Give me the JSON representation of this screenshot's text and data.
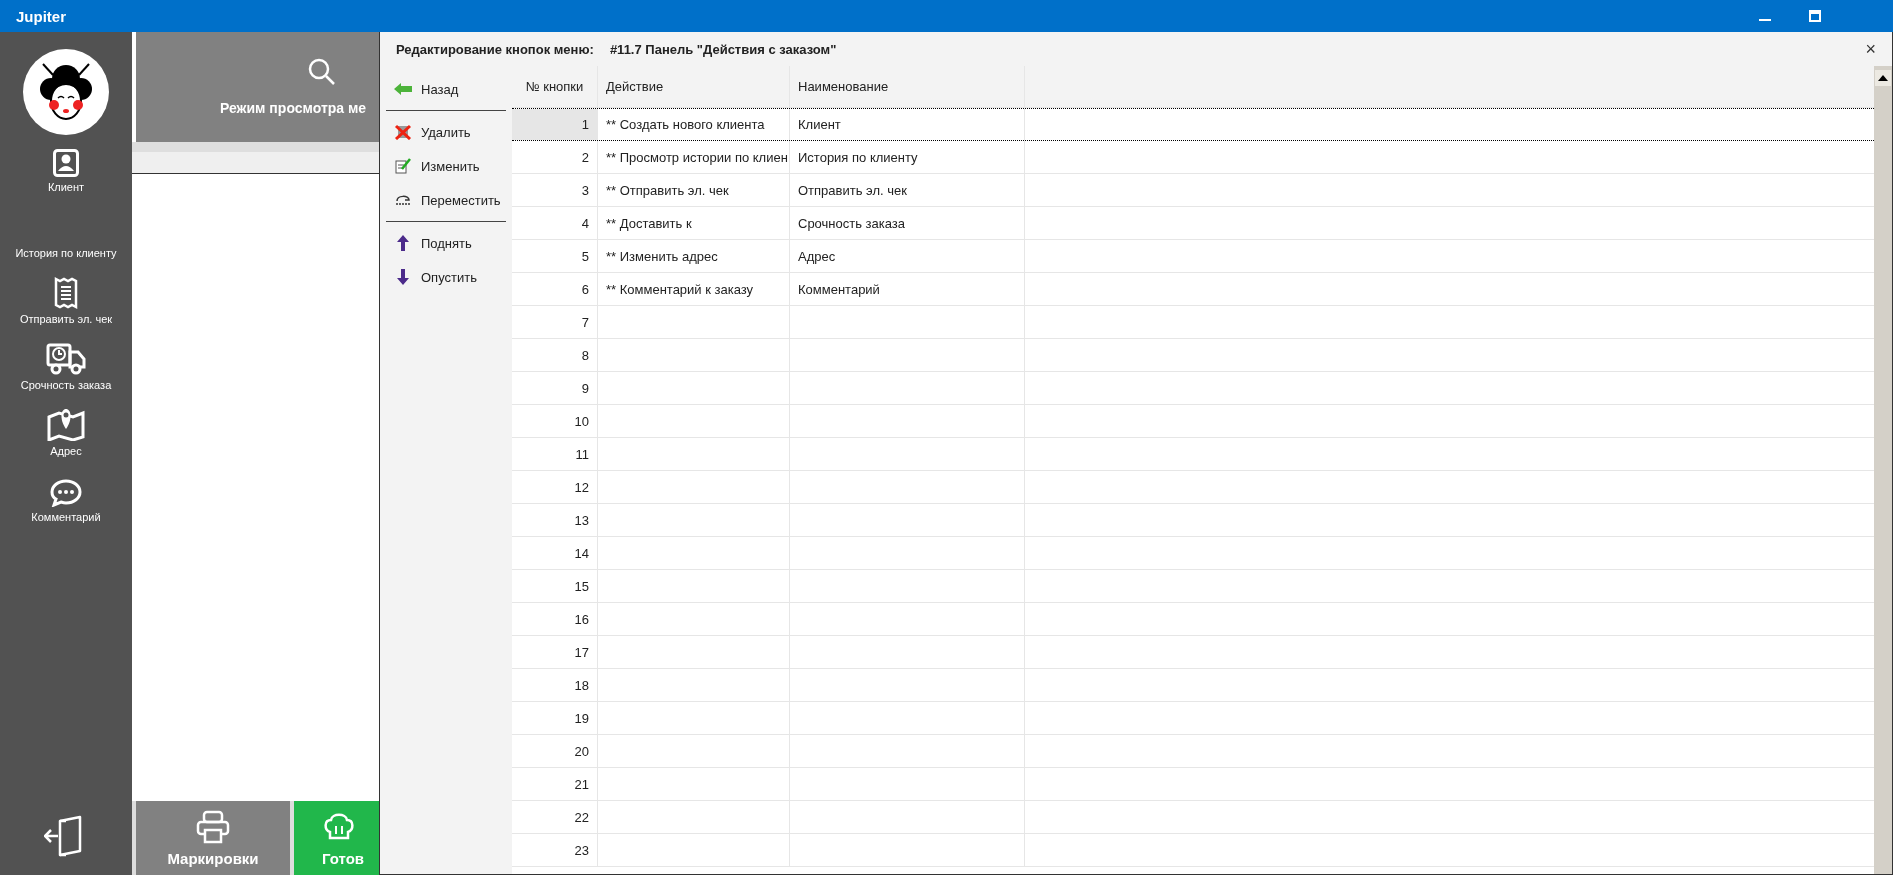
{
  "window": {
    "title": "Jupiter"
  },
  "sidebar": {
    "items": [
      {
        "label": "Клиент",
        "kind": "client"
      },
      {
        "label": "История по клиенту",
        "kind": "none"
      },
      {
        "label": "Отправить эл. чек",
        "kind": "receipt"
      },
      {
        "label": "Срочность заказа",
        "kind": "truck"
      },
      {
        "label": "Адрес",
        "kind": "map"
      },
      {
        "label": "Комментарий",
        "kind": "chat"
      }
    ]
  },
  "top_tile": {
    "label": "Режим просмотра ме"
  },
  "bottom_buttons": [
    {
      "label": "Маркировки",
      "kind": "print"
    },
    {
      "label": "Готов",
      "kind": "chef"
    }
  ],
  "dialog": {
    "title": "Редактирование кнопок меню:",
    "subtitle": "#11.7 Панель \"Действия с заказом\"",
    "close": "×",
    "toolbar": [
      {
        "label": "Назад",
        "kind": "back"
      },
      {
        "kind": "separator"
      },
      {
        "label": "Удалить",
        "kind": "delete"
      },
      {
        "label": "Изменить",
        "kind": "edit"
      },
      {
        "label": "Переместить",
        "kind": "move"
      },
      {
        "kind": "separator"
      },
      {
        "label": "Поднять",
        "kind": "up"
      },
      {
        "label": "Опустить",
        "kind": "down"
      }
    ],
    "table": {
      "columns": [
        "№ кнопки",
        "Действие",
        "Наименование"
      ],
      "rows": [
        {
          "number": "1",
          "action": "** Создать нового клиента",
          "name": "Клиент",
          "selected": true
        },
        {
          "number": "2",
          "action": "** Просмотр истории по клиен",
          "name": "История по клиенту",
          "selected": false
        },
        {
          "number": "3",
          "action": "** Отправить эл. чек",
          "name": "Отправить эл. чек",
          "selected": false
        },
        {
          "number": "4",
          "action": "** Доставить к",
          "name": "Срочность заказа",
          "selected": false
        },
        {
          "number": "5",
          "action": "** Изменить адрес",
          "name": "Адрес",
          "selected": false
        },
        {
          "number": "6",
          "action": "** Комментарий к заказу",
          "name": "Комментарий",
          "selected": false
        },
        {
          "number": "7",
          "selected": false
        },
        {
          "number": "8",
          "selected": false
        },
        {
          "number": "9",
          "selected": false
        },
        {
          "number": "10",
          "selected": false
        },
        {
          "number": "11",
          "selected": false
        },
        {
          "number": "12",
          "selected": false
        },
        {
          "number": "13",
          "selected": false
        },
        {
          "number": "14",
          "selected": false
        },
        {
          "number": "15",
          "selected": false
        },
        {
          "number": "16",
          "selected": false
        },
        {
          "number": "17",
          "selected": false
        },
        {
          "number": "18",
          "selected": false
        },
        {
          "number": "19",
          "selected": false
        },
        {
          "number": "20",
          "selected": false
        },
        {
          "number": "21",
          "selected": false
        },
        {
          "number": "22",
          "selected": false
        },
        {
          "number": "23",
          "selected": false
        }
      ]
    }
  }
}
